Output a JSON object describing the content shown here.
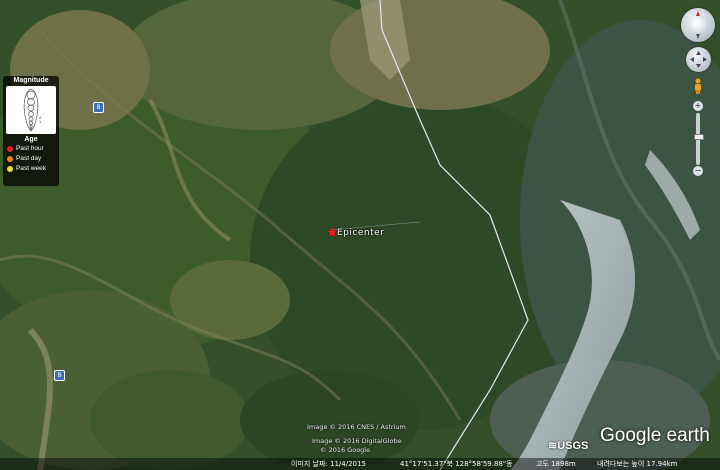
{
  "legend": {
    "magnitude_title": "Magnitude",
    "magnitude_levels": [
      "8",
      "7",
      "6",
      "5",
      "4",
      "3",
      "2",
      "1"
    ],
    "age_title": "Age",
    "age_items": [
      {
        "label": "Past hour",
        "color": "#e32222"
      },
      {
        "label": "Past day",
        "color": "#f07d1a"
      },
      {
        "label": "Past week",
        "color": "#f2e21c"
      }
    ]
  },
  "marker": {
    "label": "Epicenter",
    "color": "#ff1a1a"
  },
  "road_shields": [
    "B",
    "B"
  ],
  "credits": {
    "line1": "Image © 2016 CNES / Astrium",
    "line2": "Image © 2016 DigitalGlobe",
    "line3": "© 2016 Google"
  },
  "status_bar": {
    "image_date": "이미지 날짜: 11/4/2015",
    "coordinates": "41°17'51.37\"북 128°58'59.88\"동",
    "elevation": "고도 1898m",
    "eye_altitude": "내려다보는 높이 17.94km"
  },
  "branding": {
    "usgs": "≋USGS",
    "google_earth": "Google earth"
  },
  "controls": {
    "compass": "compass-icon",
    "look": "look-joystick-icon",
    "pegman": "street-view-icon",
    "zoom_in": "+",
    "zoom_out": "−"
  }
}
